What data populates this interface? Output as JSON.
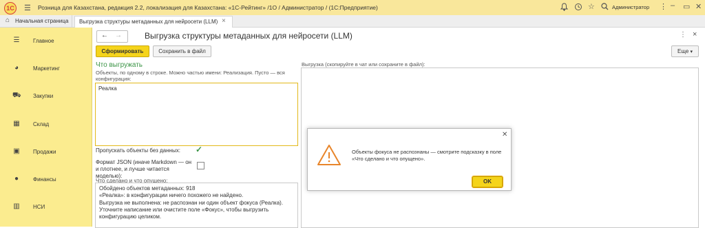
{
  "titlebar": {
    "logo_text": "1С",
    "app_title": "Розница для Казахстана, редакция 2.2, локализация для Казахстана: «1С-Рейтинг» /1O / Администратор /  (1С:Предприятие)",
    "user_name": "Администратор",
    "icons": [
      "bell-icon",
      "history-icon",
      "star-icon",
      "search-icon",
      "menu-dots-icon",
      "minimize-icon",
      "restore-icon",
      "close-icon"
    ]
  },
  "tabs": {
    "home_label": "Начальная страница",
    "active_label": "Выгрузка структуры метаданных для нейросети (LLM)"
  },
  "sidebar": {
    "background": "#fbec8f",
    "items": [
      {
        "label": "Главное",
        "icon": "menu-icon"
      },
      {
        "label": "Маркетинг",
        "icon": "pie-chart-icon"
      },
      {
        "label": "Закупки",
        "icon": "cart-icon"
      },
      {
        "label": "Склад",
        "icon": "warehouse-icon"
      },
      {
        "label": "Продажи",
        "icon": "cash-register-icon"
      },
      {
        "label": "Финансы",
        "icon": "coins-icon"
      },
      {
        "label": "НСИ",
        "icon": "books-icon"
      }
    ]
  },
  "form": {
    "title": "Выгрузка структуры метаданных для нейросети (LLM)",
    "generate_button": "Сформировать",
    "save_button": "Сохранить в файл",
    "more_button": "Еще",
    "section_title": "Что выгружать",
    "section_hint": "Объекты, по одному в строке. Можно частью имени: Реализация. Пусто — вся конфигурация:",
    "input_value": "Реалка",
    "skip_label": "Пропускать объекты без данных:",
    "skip_checked": true,
    "json_label": "Формат JSON (иначе Markdown — он и плотнее, и лучше читается моделью):",
    "json_checked": false,
    "done_label": "Что сделано и что опущено:",
    "done_lines": [
      "Обойдено объектов метаданных: 918",
      "«Реалка»: в конфигурации ничего похожего не найдено.",
      "Выгрузка не выполнена: не распознан ни один объект фокуса (Реалка).",
      "Уточните написание или очистите поле «Фокус», чтобы выгрузить конфигурацию целиком."
    ],
    "output_label": "Выгрузка (скопируйте в чат или сохраните в файл):",
    "accent_color": "#3b9446",
    "button_color": "#f5d41b"
  },
  "dialog": {
    "message": "Объекты фокуса не распознаны — смотрите подсказку в поле «Что сделано и что опущено».",
    "ok_button": "OK",
    "icon": "warning-icon",
    "icon_color": "#e8852a"
  }
}
